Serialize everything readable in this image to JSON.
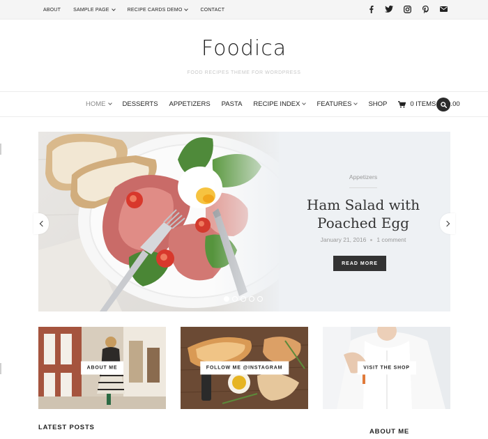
{
  "topbar": {
    "items": [
      {
        "label": "ABOUT",
        "has_dropdown": false
      },
      {
        "label": "SAMPLE PAGE",
        "has_dropdown": true
      },
      {
        "label": "RECIPE CARDS DEMO",
        "has_dropdown": true
      },
      {
        "label": "CONTACT",
        "has_dropdown": false
      }
    ],
    "social_icons": [
      "facebook-icon",
      "twitter-icon",
      "instagram-icon",
      "pinterest-icon",
      "mail-icon"
    ]
  },
  "site": {
    "title": "Foodica",
    "tagline": "FOOD RECIPES THEME FOR WORDPRESS"
  },
  "nav": {
    "items": [
      {
        "label": "HOME",
        "has_dropdown": true,
        "active": true
      },
      {
        "label": "DESSERTS",
        "has_dropdown": false
      },
      {
        "label": "APPETIZERS",
        "has_dropdown": false
      },
      {
        "label": "PASTA",
        "has_dropdown": false
      },
      {
        "label": "RECIPE INDEX",
        "has_dropdown": true
      },
      {
        "label": "FEATURES",
        "has_dropdown": true
      },
      {
        "label": "SHOP",
        "has_dropdown": false
      }
    ],
    "cart": "0 ITEMS – $0.00",
    "search_icon": "search-icon"
  },
  "slider": {
    "category": "Appetizers",
    "title": "Ham Salad with Poached Egg",
    "date": "January 21, 2016",
    "comments": "1 comment",
    "button": "READ MORE",
    "slide_count": 5,
    "active_slide": 1
  },
  "promos": [
    {
      "label": "ABOUT ME"
    },
    {
      "label": "FOLLOW ME @INSTAGRAM"
    },
    {
      "label": "VISIT THE SHOP"
    }
  ],
  "sections": {
    "latest": "LATEST POSTS",
    "about": "ABOUT ME"
  },
  "colors": {
    "dark": "#333333",
    "hero_bg": "#eef1f4",
    "muted": "#999999",
    "topbar_bg": "#f5f5f5"
  }
}
